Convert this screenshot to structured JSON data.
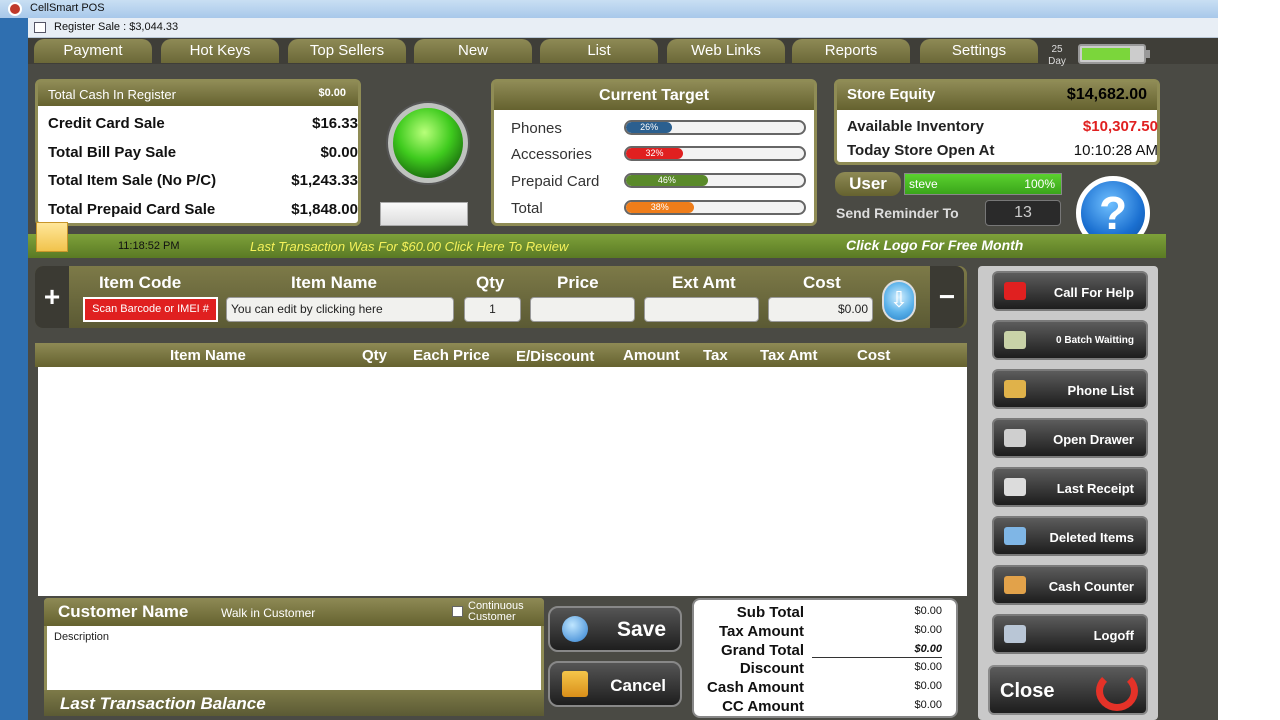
{
  "window": {
    "title": "CellSmart POS"
  },
  "tab": {
    "label": "Register Sale : $3,044.33"
  },
  "menu": [
    "Payment",
    "Hot Keys",
    "Top Sellers",
    "New",
    "List",
    "Web Links",
    "Reports",
    "Settings"
  ],
  "day": {
    "count": "25",
    "label": "Day"
  },
  "battery_level": 0.75,
  "cash": {
    "header_label": "Total Cash In Register",
    "header_value": "$0.00",
    "rows": [
      {
        "label": "Credit Card Sale",
        "value": "$16.33"
      },
      {
        "label": "Total Bill Pay Sale",
        "value": "$0.00"
      },
      {
        "label": "Total Item Sale (No P/C)",
        "value": "$1,243.33"
      },
      {
        "label": "Total Prepaid Card Sale",
        "value": "$1,848.00"
      }
    ]
  },
  "target": {
    "title": "Current Target",
    "rows": [
      {
        "label": "Phones",
        "pct": "26%",
        "level": 26,
        "color": "#2b5f8f"
      },
      {
        "label": "Accessories",
        "pct": "32%",
        "level": 32,
        "color": "#e02020"
      },
      {
        "label": "Prepaid Card",
        "pct": "46%",
        "level": 46,
        "color": "#5a8a2a"
      },
      {
        "label": "Total",
        "pct": "38%",
        "level": 38,
        "color": "#ef7d1a"
      }
    ]
  },
  "equity": {
    "label": "Store Equity",
    "value": "$14,682.00",
    "rows": [
      {
        "label": "Available Inventory",
        "value": "$10,307.50",
        "color": "#e02020"
      },
      {
        "label": "Today Store Open At",
        "value": "10:10:28 AM",
        "color": "#111111"
      }
    ]
  },
  "user": {
    "badge": "User",
    "name": "steve",
    "pct": "100%"
  },
  "reminder": {
    "label": "Send Reminder To",
    "value": "13"
  },
  "help": {
    "glyph": "?"
  },
  "status": {
    "time": "11:18:52 PM",
    "last_txn": "Last Transaction Was For $60.00 Click Here To Review",
    "promo": "Click Logo For Free Month"
  },
  "entry": {
    "headers": [
      "Item Code",
      "Item Name",
      "Qty",
      "Price",
      "Ext Amt",
      "Cost"
    ],
    "scan_label": "Scan Barcode or IMEI #",
    "item_name": "You can edit by clicking here",
    "qty": "1",
    "price": "",
    "ext_amt": "",
    "cost": "$0.00",
    "plus": "+",
    "minus": "−",
    "down": "⇩"
  },
  "grid": {
    "headers": [
      "Item Name",
      "Qty",
      "Each Price",
      "E/Discount",
      "Amount",
      "Tax",
      "Tax Amt",
      "Cost"
    ]
  },
  "customer": {
    "title": "Customer Name",
    "value": "Walk in Customer",
    "continuous": "Continuous Customer",
    "description": "Description",
    "footer": "Last Transaction Balance"
  },
  "actions": {
    "save": "Save",
    "cancel": "Cancel"
  },
  "totals": [
    {
      "label": "Sub Total",
      "value": "$0.00"
    },
    {
      "label": "Tax Amount",
      "value": "$0.00"
    },
    {
      "label": "Grand Total",
      "value": "$0.00"
    },
    {
      "label": "Discount",
      "value": "$0.00"
    },
    {
      "label": "Cash Amount",
      "value": "$0.00"
    },
    {
      "label": "CC Amount",
      "value": "$0.00"
    }
  ],
  "sidebar": [
    {
      "label": "Call For Help",
      "icon": "alarm-icon",
      "color": "#e02020"
    },
    {
      "label": "0 Batch Waitting",
      "icon": "batch-icon",
      "color": "#c9d2a8"
    },
    {
      "label": "Phone List",
      "icon": "phone-list-icon",
      "color": "#e0b24a"
    },
    {
      "label": "Open Drawer",
      "icon": "drawer-icon",
      "color": "#cfcfcf"
    },
    {
      "label": "Last Receipt",
      "icon": "printer-icon",
      "color": "#dcdcdc"
    },
    {
      "label": "Deleted Items",
      "icon": "trash-icon",
      "color": "#7fb6e6"
    },
    {
      "label": "Cash Counter",
      "icon": "cash-counter-icon",
      "color": "#e2a24a"
    },
    {
      "label": "Logoff",
      "icon": "key-icon",
      "color": "#b9c6d6"
    }
  ],
  "close": {
    "label": "Close"
  }
}
